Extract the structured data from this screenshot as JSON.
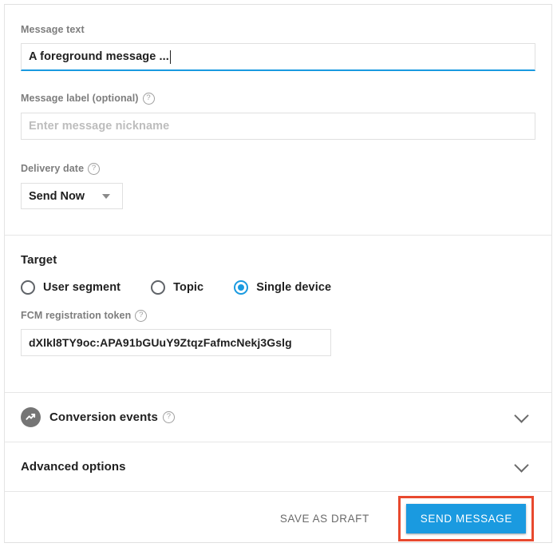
{
  "form": {
    "message_text": {
      "label": "Message text",
      "value": "A foreground message ...",
      "has_help": false
    },
    "message_label": {
      "label": "Message label (optional)",
      "value": "",
      "placeholder": "Enter message nickname",
      "help_glyph": "?"
    },
    "delivery_date": {
      "label": "Delivery date",
      "help_glyph": "?",
      "selected": "Send Now"
    },
    "target": {
      "title": "Target",
      "options": [
        {
          "label": "User segment",
          "checked": false
        },
        {
          "label": "Topic",
          "checked": false
        },
        {
          "label": "Single device",
          "checked": true
        }
      ],
      "token": {
        "label": "FCM registration token",
        "help_glyph": "?",
        "value": "dXlkl8TY9oc:APA91bGUuY9ZtqzFafmcNekj3Gslg"
      }
    },
    "conversion_events": {
      "title": "Conversion events",
      "help_glyph": "?",
      "expanded": false
    },
    "advanced_options": {
      "title": "Advanced options",
      "expanded": false
    }
  },
  "footer": {
    "save_draft_label": "SAVE AS DRAFT",
    "send_label": "SEND MESSAGE"
  },
  "colors": {
    "accent_blue": "#1a9ae0",
    "annotation_red": "#e8492e",
    "label_gray": "#7d7d7d",
    "text_dark": "#1f1f1f",
    "placeholder_gray": "#bdbdbd",
    "border_gray": "#e0e0e0",
    "badge_gray": "#757575"
  }
}
